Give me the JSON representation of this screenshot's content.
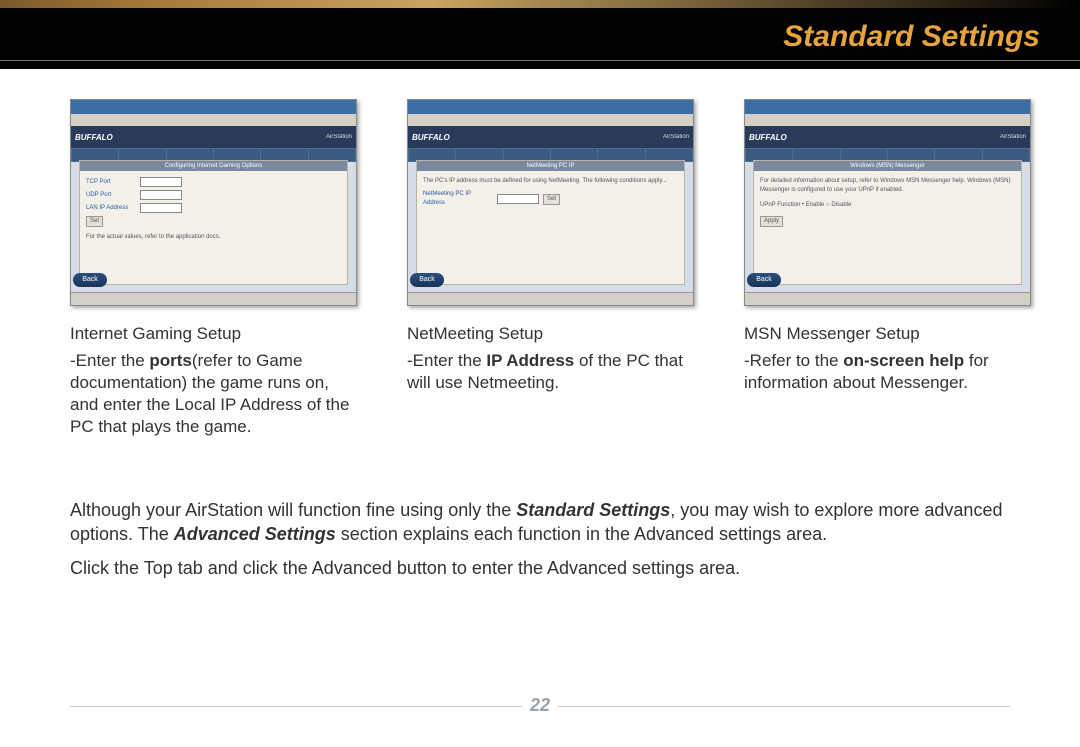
{
  "header": {
    "title": "Standard Settings"
  },
  "columns": [
    {
      "title": "Internet Gaming Setup",
      "desc_pre": "-Enter the ",
      "desc_bold": "ports",
      "desc_post": "(refer to Game documentation) the game runs on, and enter the Local IP Address of the PC that plays the game.",
      "shot": {
        "brand": "BUFFALO",
        "brand_right": "AirStation",
        "panel": "Configuring Internet Gaming Options",
        "fields": [
          "TCP Port",
          "UDP Port",
          "LAN IP Address"
        ],
        "note": "For the actual values, refer to the application docs.",
        "back": "Back",
        "set": "Set"
      }
    },
    {
      "title": "NetMeeting Setup",
      "desc_pre": "-Enter the ",
      "desc_bold": "IP Address",
      "desc_post": " of the PC that will use Netmeeting.",
      "shot": {
        "brand": "BUFFALO",
        "brand_right": "AirStation",
        "panel": "NetMeeting PC IP",
        "field_label": "NetMeeting PC IP Address",
        "note": "The PC's IP address must be defined for using NetMeeting. The following conditions apply...",
        "back": "Back",
        "set": "Set"
      }
    },
    {
      "title": "MSN Messenger Setup",
      "desc_pre": "-Refer to the ",
      "desc_bold": "on-screen help",
      "desc_post": " for information about Messenger.",
      "shot": {
        "brand": "BUFFALO",
        "brand_right": "AirStation",
        "panel": "Windows (MSN) Messenger",
        "note": "For detailed information about setup, refer to Windows MSN Messenger help. Windows (MSN) Messenger is configured to use your UPnP if enabled.",
        "radio": "UPnP Function   • Enable   ○ Disable",
        "back": "Back",
        "apply": "Apply"
      }
    }
  ],
  "paragraph1_a": "Although your AirStation will function fine using only the ",
  "paragraph1_b": "Standard Settings",
  "paragraph1_c": ", you may wish to explore more advanced options.  The ",
  "paragraph1_d": "Advanced Settings",
  "paragraph1_e": " section explains each function in the Advanced settings area.",
  "paragraph2": "Click the Top tab and click the Advanced button to enter the Advanced settings area.",
  "page_number": "22"
}
